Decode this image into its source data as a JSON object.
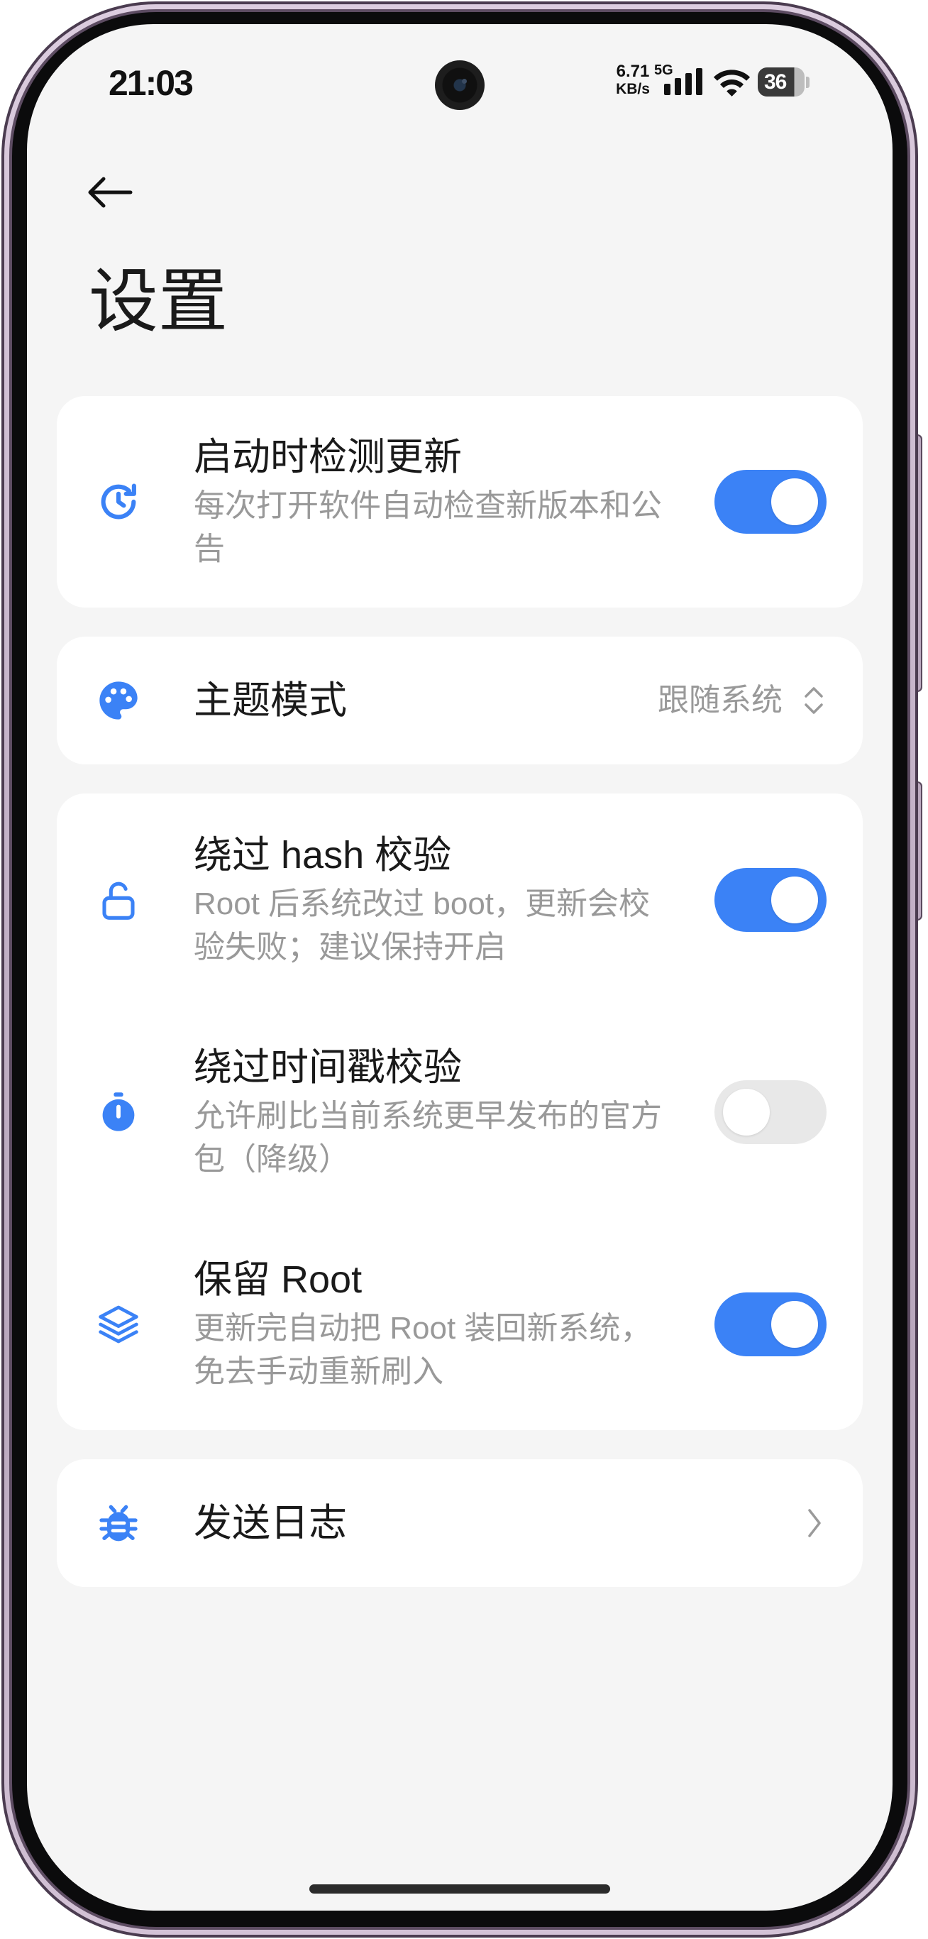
{
  "status_bar": {
    "time": "21:03",
    "net_speed": "6.71",
    "net_speed_unit": "KB/s",
    "network_type": "5G",
    "battery_level": "36",
    "signal_icon": "signal-bars-icon",
    "wifi_icon": "wifi-icon"
  },
  "header": {
    "back_icon": "arrow-left-icon",
    "title": "设置"
  },
  "settings": {
    "check_update": {
      "icon": "clock-refresh-icon",
      "title": "启动时检测更新",
      "subtitle": "每次打开软件自动检查新版本和公告",
      "enabled": true
    },
    "theme_mode": {
      "icon": "palette-icon",
      "title": "主题模式",
      "value": "跟随系统",
      "value_icon": "chevron-up-down-icon"
    },
    "bypass_hash": {
      "icon": "unlock-icon",
      "title": "绕过 hash 校验",
      "subtitle": "Root 后系统改过 boot，更新会校验失败；建议保持开启",
      "enabled": true
    },
    "bypass_timestamp": {
      "icon": "stopwatch-icon",
      "title": "绕过时间戳校验",
      "subtitle": "允许刷比当前系统更早发布的官方包（降级）",
      "enabled": false
    },
    "keep_root": {
      "icon": "layers-icon",
      "title": "保留 Root",
      "subtitle": "更新完自动把 Root 装回新系统，免去手动重新刷入",
      "enabled": true
    },
    "send_log": {
      "icon": "bug-icon",
      "title": "发送日志",
      "value_icon": "chevron-right-icon"
    }
  },
  "colors": {
    "accent": "#3b82f6",
    "toggle_off": "#e8e8e8",
    "screen_background": "#f5f5f5",
    "card_background": "#ffffff",
    "primary_text": "#1a1a1a",
    "secondary_text": "#999999"
  }
}
